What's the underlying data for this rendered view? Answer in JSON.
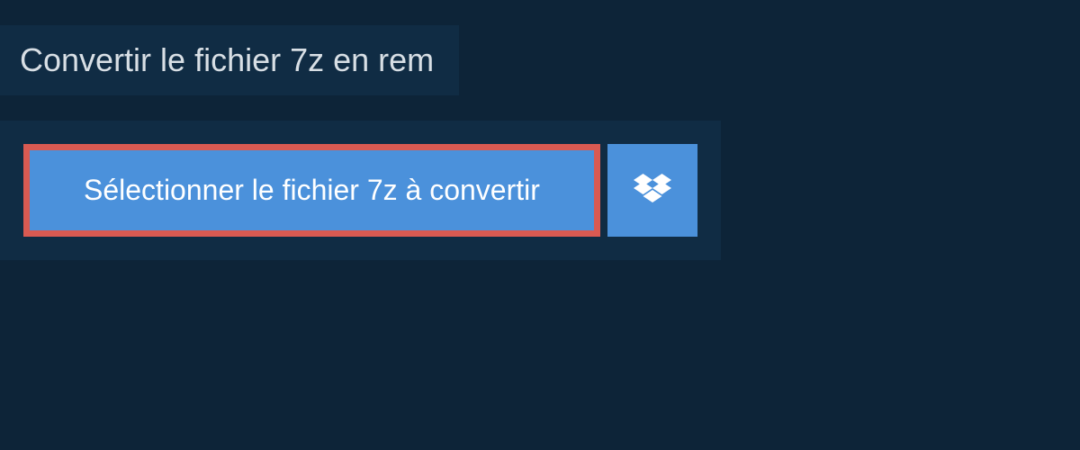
{
  "header": {
    "title": "Convertir le fichier 7z en rem"
  },
  "actions": {
    "select_file_label": "Sélectionner le fichier 7z à convertir"
  },
  "colors": {
    "background": "#0d2438",
    "panel": "#102c44",
    "button_primary": "#4b91db",
    "highlight_border": "#d95a52",
    "text_light": "#d8dfe5",
    "text_white": "#ffffff"
  }
}
